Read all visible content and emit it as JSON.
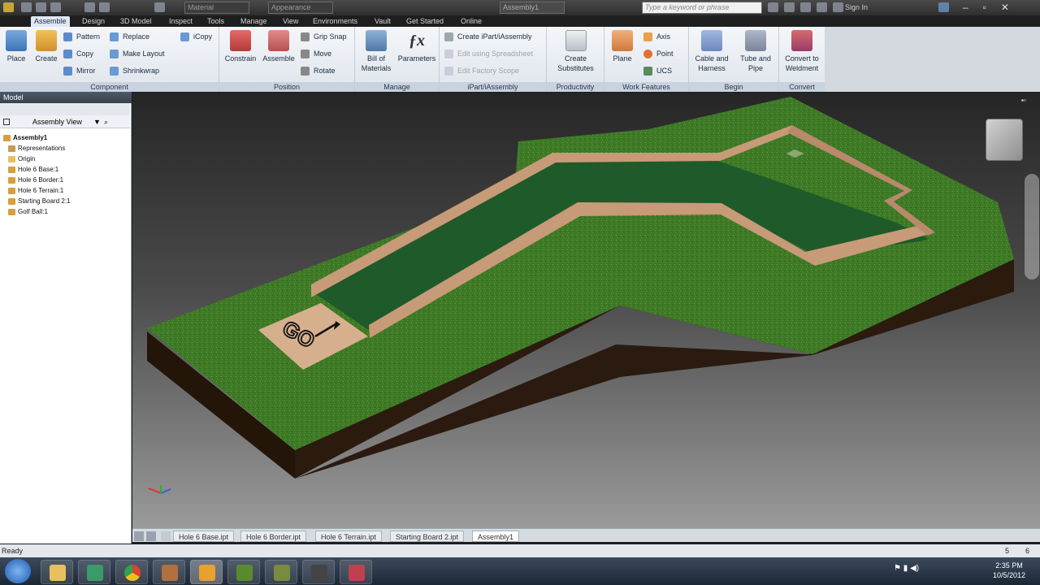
{
  "qat": {
    "material": "Material",
    "appearance": "Appearance",
    "title": "Assembly1",
    "search_placeholder": "Type a keyword or phrase",
    "sign_in": "Sign In"
  },
  "tabs": [
    "Assemble",
    "Design",
    "3D Model",
    "Inspect",
    "Tools",
    "Manage",
    "View",
    "Environments",
    "Vault",
    "Get Started",
    "Online"
  ],
  "ribbon": {
    "component": {
      "title": "Component",
      "place": "Place",
      "create": "Create",
      "pattern": "Pattern",
      "copy": "Copy",
      "mirror": "Mirror",
      "replace": "Replace",
      "make_layout": "Make Layout",
      "shrinkwrap": "Shrinkwrap",
      "icopy": "iCopy"
    },
    "position": {
      "title": "Position",
      "constrain": "Constrain",
      "assemble": "Assemble",
      "grip_snap": "Grip Snap",
      "move": "Move",
      "rotate": "Rotate"
    },
    "manage": {
      "title": "Manage",
      "bom1": "Bill of",
      "bom2": "Materials",
      "parameters": "Parameters"
    },
    "ipart": {
      "title": "iPart/iAssembly",
      "create": "Create iPart/iAssembly",
      "edit_sheet": "Edit using Spreadsheet",
      "edit_scope": "Edit Factory Scope"
    },
    "productivity": {
      "title": "Productivity",
      "l1": "Create",
      "l2": "Substitutes"
    },
    "work": {
      "title": "Work Features",
      "plane": "Plane",
      "axis": "Axis",
      "point": "Point",
      "ucs": "UCS"
    },
    "begin": {
      "title": "Begin",
      "cable1": "Cable and",
      "cable2": "Harness",
      "tube1": "Tube and",
      "tube2": "Pipe"
    },
    "convert": {
      "title": "Convert",
      "l1": "Convert to",
      "l2": "Weldment"
    }
  },
  "browser": {
    "header": "Model",
    "view": "Assembly View",
    "root": "Assembly1",
    "items": [
      "Representations",
      "Origin",
      "Hole 6 Base:1",
      "Hole 6 Border:1",
      "Hole 6 Terrain:1",
      "Starting Board 2:1",
      "Golf Ball:1"
    ]
  },
  "viewport": {
    "start_label": "GO"
  },
  "doc_tabs": [
    "Hole 6 Base.ipt",
    "Hole 6 Border.ipt",
    "Hole 6 Terrain.ipt",
    "Starting Board 2.ipt",
    "Assembly1"
  ],
  "status": {
    "text": "Ready",
    "n1": "5",
    "n2": "6"
  },
  "clock": {
    "time": "2:35 PM",
    "date": "10/5/2012"
  },
  "colors": {
    "grass": "#3e7a26",
    "fairway": "#1f5a2a",
    "border_wood": "#c79a78",
    "ground": "#2a1a10",
    "tee": "#d6b08c"
  }
}
